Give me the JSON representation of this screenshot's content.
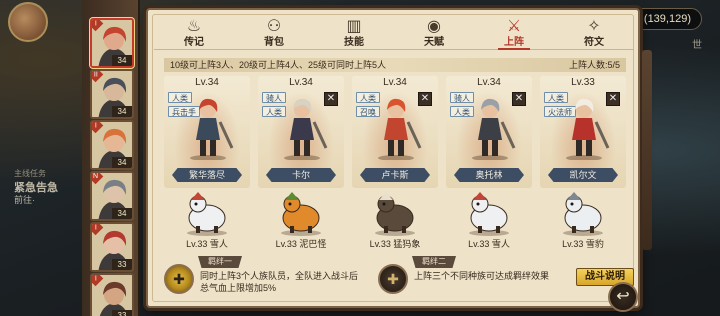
{
  "currency": {
    "value": "(139,129)"
  },
  "right_marker": "世",
  "quest": {
    "title": "主线任务",
    "name": "紧急告急",
    "detail": "前往·"
  },
  "roster": [
    {
      "level": "34",
      "tag": "I",
      "color": "#c3452f",
      "skin": "#e0a98b"
    },
    {
      "level": "34",
      "tag": "II",
      "color": "#4b4f5a",
      "skin": "#d8b89a"
    },
    {
      "level": "34",
      "tag": "I",
      "color": "#d9713a",
      "skin": "#e6b795"
    },
    {
      "level": "34",
      "tag": "N",
      "color": "#7a7f86",
      "skin": "#dcc3a9"
    },
    {
      "level": "33",
      "tag": "I",
      "color": "#b33a2f",
      "skin": "#e6c0a6"
    },
    {
      "level": "33",
      "tag": "I",
      "color": "#6b3a2a",
      "skin": "#d4a583"
    }
  ],
  "tabs": [
    {
      "label": "传记",
      "icon": "flame-icon",
      "glyph": "♨"
    },
    {
      "label": "背包",
      "icon": "bag-icon",
      "glyph": "⚇"
    },
    {
      "label": "技能",
      "icon": "book-icon",
      "glyph": "▥"
    },
    {
      "label": "天赋",
      "icon": "eye-icon",
      "glyph": "◉"
    },
    {
      "label": "上阵",
      "icon": "crossed-swords-icon",
      "glyph": "⚔",
      "active": true
    },
    {
      "label": "符文",
      "icon": "rune-icon",
      "glyph": "✧"
    }
  ],
  "info": {
    "rule": "10级可上阵3人、20级可上阵4人、25级可同时上阵5人",
    "count": "上阵人数:5/5"
  },
  "heroes": [
    {
      "level": "Lv.34",
      "tag1": "人类",
      "tag2": "兵击手",
      "name": "繁华落尽",
      "removable": false,
      "hair": "#c7432e",
      "cloth": "#3a4a5a"
    },
    {
      "level": "Lv.34",
      "tag1": "骑人",
      "tag2": "人类",
      "name": "卡尔",
      "removable": true,
      "hair": "#d8d2c3",
      "cloth": "#3b3a4d"
    },
    {
      "level": "Lv.34",
      "tag1": "人类",
      "tag2": "召唤",
      "name": "卢卡斯",
      "removable": true,
      "hair": "#d9542e",
      "cloth": "#c24530"
    },
    {
      "level": "Lv.34",
      "tag1": "骑人",
      "tag2": "人类",
      "name": "奥托林",
      "removable": true,
      "hair": "#9aa0a6",
      "cloth": "#3c3f45"
    },
    {
      "level": "Lv.33",
      "tag1": "人类",
      "tag2": "火法师",
      "name": "凯尔文",
      "removable": true,
      "hair": "#f1ede3",
      "cloth": "#b6322b"
    }
  ],
  "pets": [
    {
      "label": "Lv.33 雪人",
      "body": "#eef0f2",
      "accent": "#c24536"
    },
    {
      "label": "Lv.33 泥巴怪",
      "body": "#e08a2c",
      "accent": "#5e8a34"
    },
    {
      "label": "Lv.33 猛犸象",
      "body": "#5a4a3c",
      "accent": "#e8e0cc"
    },
    {
      "label": "Lv.33 雪人",
      "body": "#eef0f2",
      "accent": "#c24536"
    },
    {
      "label": "Lv.33 雪豹",
      "body": "#eceff2",
      "accent": "#7f8790"
    }
  ],
  "bonds": [
    {
      "title": "羁绊一",
      "lines": [
        "同时上阵3个人族队员，全队进入战斗后",
        "总气血上限增加5%"
      ]
    },
    {
      "title": "羁绊二",
      "lines": [
        "上阵三个不同种族可达成羁绊效果"
      ]
    }
  ],
  "battle_button": "战斗说明",
  "return_glyph": "↩"
}
